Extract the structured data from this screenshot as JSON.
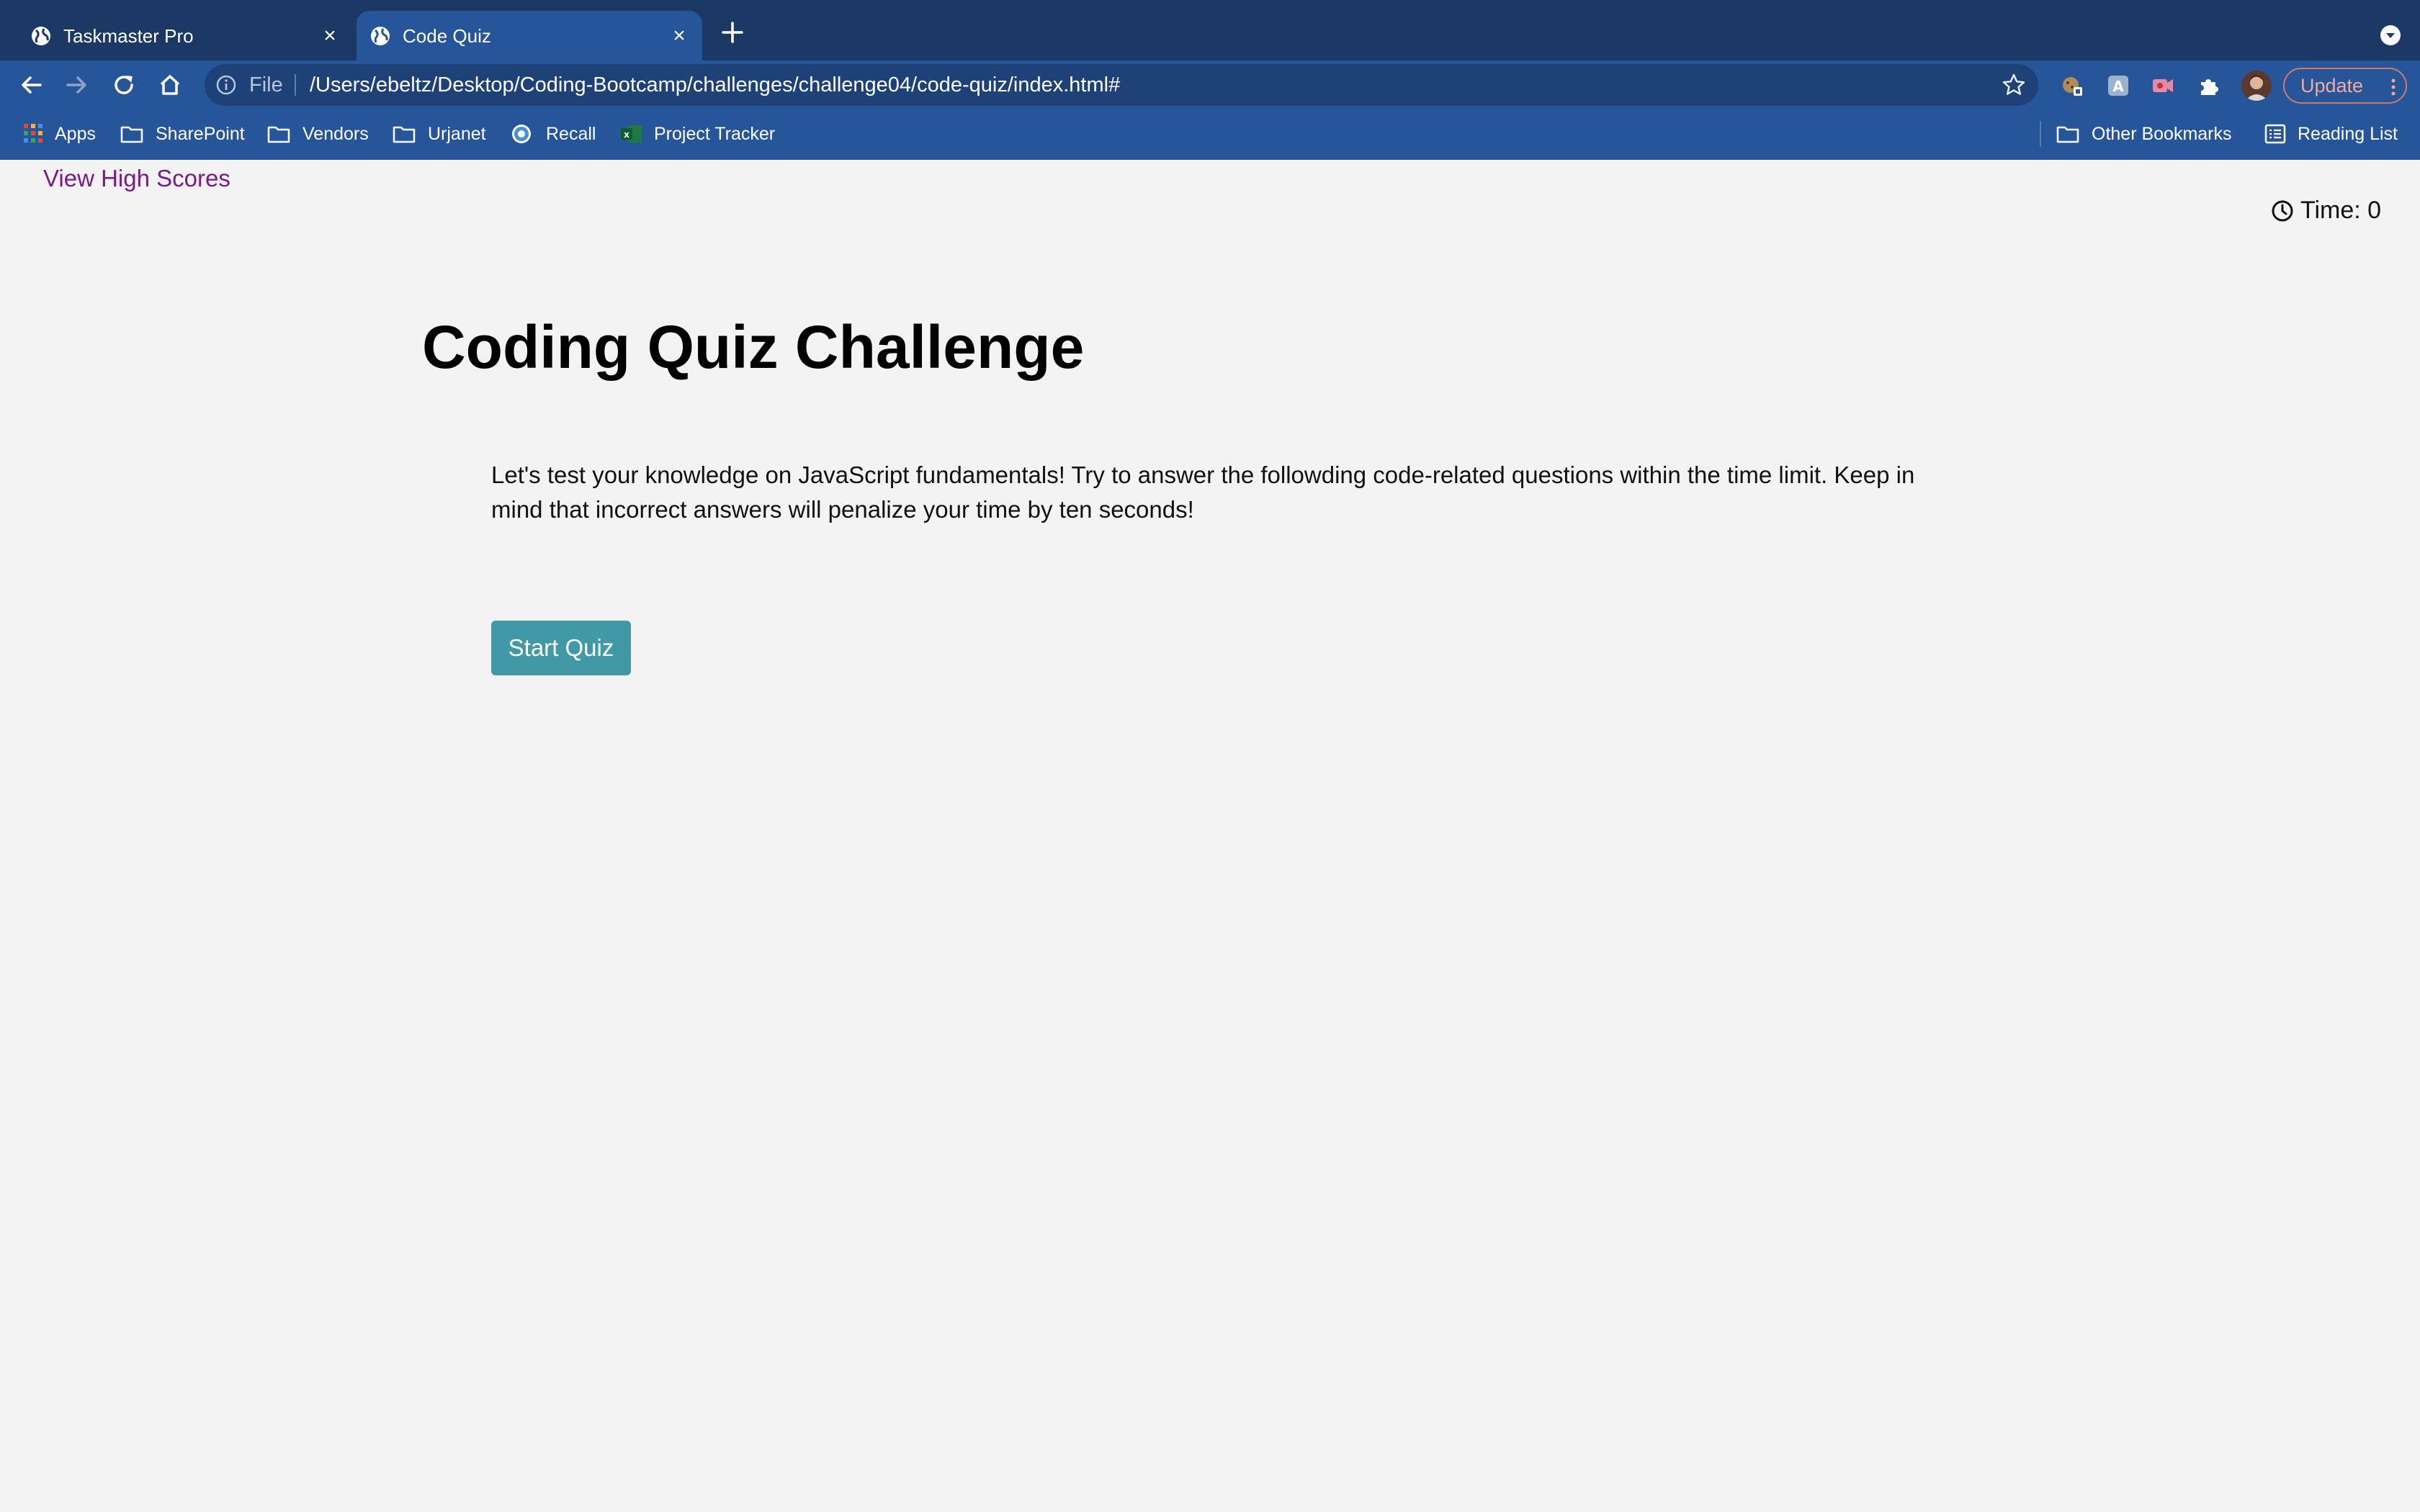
{
  "browser": {
    "tabs": [
      {
        "title": "Taskmaster Pro",
        "close": "×"
      },
      {
        "title": "Code Quiz",
        "close": "×"
      }
    ],
    "omnibox": {
      "scheme_label": "File",
      "url": "/Users/ebeltz/Desktop/Coding-Bootcamp/challenges/challenge04/code-quiz/index.html#"
    },
    "update_label": "Update",
    "bookmarks": [
      {
        "label": "Apps",
        "icon": "apps-grid-icon"
      },
      {
        "label": "SharePoint",
        "icon": "folder-icon"
      },
      {
        "label": "Vendors",
        "icon": "folder-icon"
      },
      {
        "label": "Urjanet",
        "icon": "folder-icon"
      },
      {
        "label": "Recall",
        "icon": "recall-icon"
      },
      {
        "label": "Project Tracker",
        "icon": "excel-icon"
      }
    ],
    "other_bookmarks": "Other Bookmarks",
    "reading_list": "Reading List"
  },
  "page": {
    "high_scores_link": "View High Scores",
    "timer_text": "Time: 0",
    "title": "Coding Quiz Challenge",
    "description": "Let's test your knowledge on JavaScript fundamentals! Try to answer the followding code-related questions within the time limit. Keep in mind that incorrect answers will penalize your time by ten seconds!",
    "start_button": "Start Quiz"
  },
  "colors": {
    "tab_strip": "#1c3966",
    "toolbar": "#27559a",
    "page_background": "#f3f3f3",
    "link": "#7a1a86",
    "start_button": "#4199a8"
  }
}
